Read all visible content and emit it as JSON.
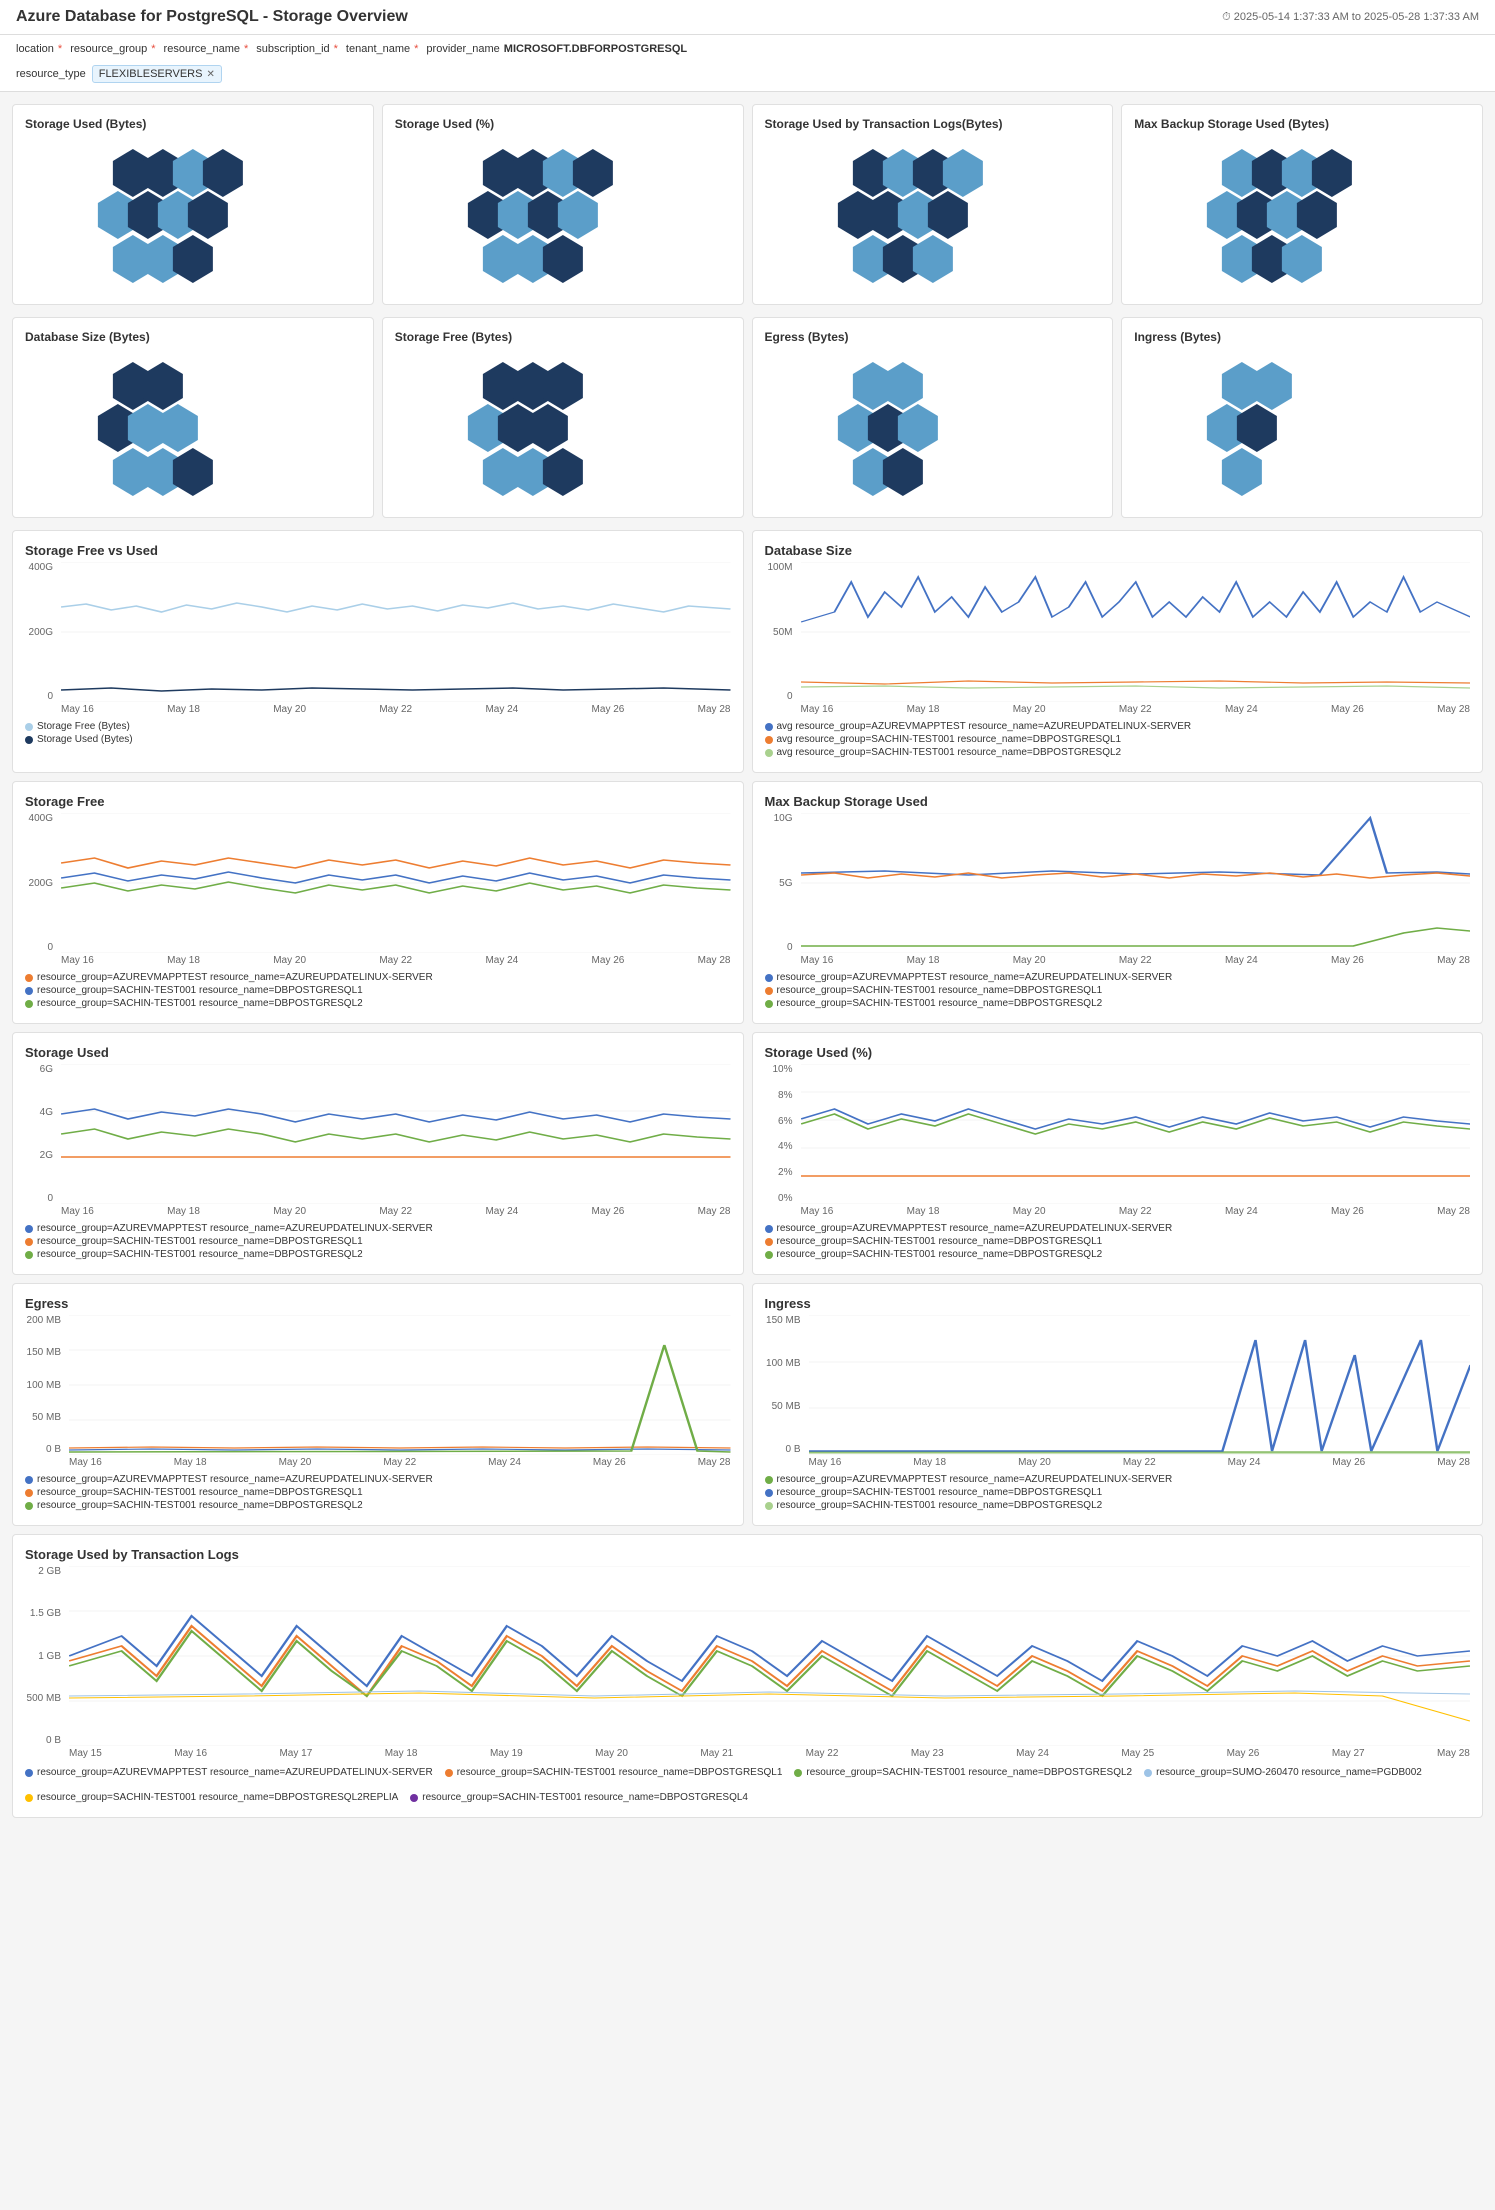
{
  "header": {
    "title": "Azure Database for PostgreSQL - Storage Overview",
    "time_range": "⏱ 2025-05-14 1:37:33 AM to 2025-05-28 1:37:33 AM"
  },
  "filters": {
    "items": [
      {
        "label": "location",
        "required": true
      },
      {
        "label": "resource_group",
        "required": true
      },
      {
        "label": "resource_name",
        "required": true
      },
      {
        "label": "subscription_id",
        "required": true
      },
      {
        "label": "tenant_name",
        "required": true
      },
      {
        "label": "provider_name",
        "required": false,
        "value": "MICROSOFT.DBFORPOSTGRESQL"
      }
    ],
    "tags": [
      {
        "label": "resource_type",
        "value": "FLEXIBLESERVERS"
      }
    ]
  },
  "hexmap_cards": [
    {
      "title": "Storage Used (Bytes)",
      "id": "storage-used-bytes"
    },
    {
      "title": "Storage Used (%)",
      "id": "storage-used-pct"
    },
    {
      "title": "Storage Used by Transaction Logs(Bytes)",
      "id": "storage-used-txlogs"
    },
    {
      "title": "Max Backup Storage Used (Bytes)",
      "id": "max-backup-storage"
    },
    {
      "title": "Database Size (Bytes)",
      "id": "database-size"
    },
    {
      "title": "Storage Free (Bytes)",
      "id": "storage-free"
    },
    {
      "title": "Egress (Bytes)",
      "id": "egress-bytes"
    },
    {
      "title": "Ingress (Bytes)",
      "id": "ingress-bytes"
    }
  ],
  "charts": {
    "storage_free_vs_used": {
      "title": "Storage Free vs Used",
      "y_axis": [
        "400G",
        "200G",
        "0"
      ],
      "x_axis": [
        "May 16",
        "May 18",
        "May 20",
        "May 22",
        "May 24",
        "May 26",
        "May 28"
      ],
      "legend": [
        {
          "color": "#aacfe8",
          "label": "Storage Free (Bytes)"
        },
        {
          "color": "#003865",
          "label": "Storage Used (Bytes)"
        }
      ]
    },
    "database_size": {
      "title": "Database Size",
      "y_axis": [
        "100M",
        "50M",
        "0"
      ],
      "x_axis": [
        "May 16",
        "May 18",
        "May 20",
        "May 22",
        "May 24",
        "May 26",
        "May 28"
      ],
      "legend": [
        {
          "color": "#4472c4",
          "label": "avg resource_group=AZUREVMAPPTEST resource_name=AZUREUPDATELINUX-SERVER"
        },
        {
          "color": "#ed7d31",
          "label": "avg resource_group=SACHIN-TEST001 resource_name=DBPOSTGRESQL1"
        },
        {
          "color": "#a9d18e",
          "label": "avg resource_group=SACHIN-TEST001 resource_name=DBPOSTGRESQL2"
        }
      ]
    },
    "storage_free": {
      "title": "Storage Free",
      "y_axis": [
        "400G",
        "200G",
        "0"
      ],
      "x_axis": [
        "May 16",
        "May 18",
        "May 20",
        "May 22",
        "May 24",
        "May 26",
        "May 28"
      ],
      "legend": [
        {
          "color": "#ed7d31",
          "label": "resource_group=AZUREVMAPPTEST resource_name=AZUREUPDATELINUX-SERVER"
        },
        {
          "color": "#4472c4",
          "label": "resource_group=SACHIN-TEST001 resource_name=DBPOSTGRESQL1"
        },
        {
          "color": "#70ad47",
          "label": "resource_group=SACHIN-TEST001 resource_name=DBPOSTGRESQL2"
        }
      ]
    },
    "max_backup_storage": {
      "title": "Max Backup Storage Used",
      "y_axis": [
        "10G",
        "5G",
        "0"
      ],
      "x_axis": [
        "May 16",
        "May 18",
        "May 20",
        "May 22",
        "May 24",
        "May 26",
        "May 28"
      ],
      "legend": [
        {
          "color": "#4472c4",
          "label": "resource_group=AZUREVMAPPTEST resource_name=AZUREUPDATELINUX-SERVER"
        },
        {
          "color": "#ed7d31",
          "label": "resource_group=SACHIN-TEST001 resource_name=DBPOSTGRESQL1"
        },
        {
          "color": "#70ad47",
          "label": "resource_group=SACHIN-TEST001 resource_name=DBPOSTGRESQL2"
        }
      ]
    },
    "storage_used": {
      "title": "Storage Used",
      "y_axis": [
        "6G",
        "4G",
        "2G",
        "0"
      ],
      "x_axis": [
        "May 16",
        "May 18",
        "May 20",
        "May 22",
        "May 24",
        "May 26",
        "May 28"
      ],
      "legend": [
        {
          "color": "#4472c4",
          "label": "resource_group=AZUREVMAPPTEST resource_name=AZUREUPDATELINUX-SERVER"
        },
        {
          "color": "#ed7d31",
          "label": "resource_group=SACHIN-TEST001 resource_name=DBPOSTGRESQL1"
        },
        {
          "color": "#70ad47",
          "label": "resource_group=SACHIN-TEST001 resource_name=DBPOSTGRESQL2"
        }
      ]
    },
    "storage_used_pct": {
      "title": "Storage Used (%)",
      "y_axis": [
        "10%",
        "8%",
        "6%",
        "4%",
        "2%",
        "0%"
      ],
      "x_axis": [
        "May 16",
        "May 18",
        "May 20",
        "May 22",
        "May 24",
        "May 26",
        "May 28"
      ],
      "legend": [
        {
          "color": "#4472c4",
          "label": "resource_group=AZUREVMAPPTEST resource_name=AZUREUPDATELINUX-SERVER"
        },
        {
          "color": "#ed7d31",
          "label": "resource_group=SACHIN-TEST001 resource_name=DBPOSTGRESQL1"
        },
        {
          "color": "#70ad47",
          "label": "resource_group=SACHIN-TEST001 resource_name=DBPOSTGRESQL2"
        }
      ]
    },
    "egress": {
      "title": "Egress",
      "y_axis": [
        "200 MB",
        "150 MB",
        "100 MB",
        "50 MB",
        "0 B"
      ],
      "x_axis": [
        "May 16",
        "May 18",
        "May 20",
        "May 22",
        "May 24",
        "May 26",
        "May 28"
      ],
      "legend": [
        {
          "color": "#4472c4",
          "label": "resource_group=AZUREVMAPPTEST resource_name=AZUREUPDATELINUX-SERVER"
        },
        {
          "color": "#ed7d31",
          "label": "resource_group=SACHIN-TEST001 resource_name=DBPOSTGRESQL1"
        },
        {
          "color": "#70ad47",
          "label": "resource_group=SACHIN-TEST001 resource_name=DBPOSTGRESQL2"
        }
      ]
    },
    "ingress": {
      "title": "Ingress",
      "y_axis": [
        "150 MB",
        "100 MB",
        "50 MB",
        "0 B"
      ],
      "x_axis": [
        "May 16",
        "May 18",
        "May 20",
        "May 22",
        "May 24",
        "May 26",
        "May 28"
      ],
      "legend": [
        {
          "color": "#70ad47",
          "label": "resource_group=AZUREVMAPPTEST resource_name=AZUREUPDATELINUX-SERVER"
        },
        {
          "color": "#4472c4",
          "label": "resource_group=SACHIN-TEST001 resource_name=DBPOSTGRESQL1"
        },
        {
          "color": "#a9d18e",
          "label": "resource_group=SACHIN-TEST001 resource_name=DBPOSTGRESQL2"
        }
      ]
    },
    "storage_txlogs": {
      "title": "Storage Used by Transaction Logs",
      "y_axis": [
        "2 GB",
        "1.5 GB",
        "1 GB",
        "500 MB",
        "0 B"
      ],
      "x_axis": [
        "May 15",
        "May 16",
        "May 17",
        "May 18",
        "May 19",
        "May 20",
        "May 21",
        "May 22",
        "May 23",
        "May 24",
        "May 25",
        "May 26",
        "May 27",
        "May 28"
      ],
      "legend": [
        {
          "color": "#4472c4",
          "label": "resource_group=AZUREVMAPPTEST resource_name=AZUREUPDATELINUX-SERVER"
        },
        {
          "color": "#ed7d31",
          "label": "resource_group=SACHIN-TEST001 resource_name=DBPOSTGRESQL1"
        },
        {
          "color": "#70ad47",
          "label": "resource_group=SACHIN-TEST001 resource_name=DBPOSTGRESQL2"
        },
        {
          "color": "#9dc3e6",
          "label": "resource_group=SUMO-260470 resource_name=PGDB002"
        },
        {
          "color": "#ffc000",
          "label": "resource_group=SACHIN-TEST001 resource_name=DBPOSTGRESQL2REPLIA"
        },
        {
          "color": "#7030a0",
          "label": "resource_group=SACHIN-TEST001 resource_name=DBPOSTGRESQL4"
        }
      ]
    }
  }
}
